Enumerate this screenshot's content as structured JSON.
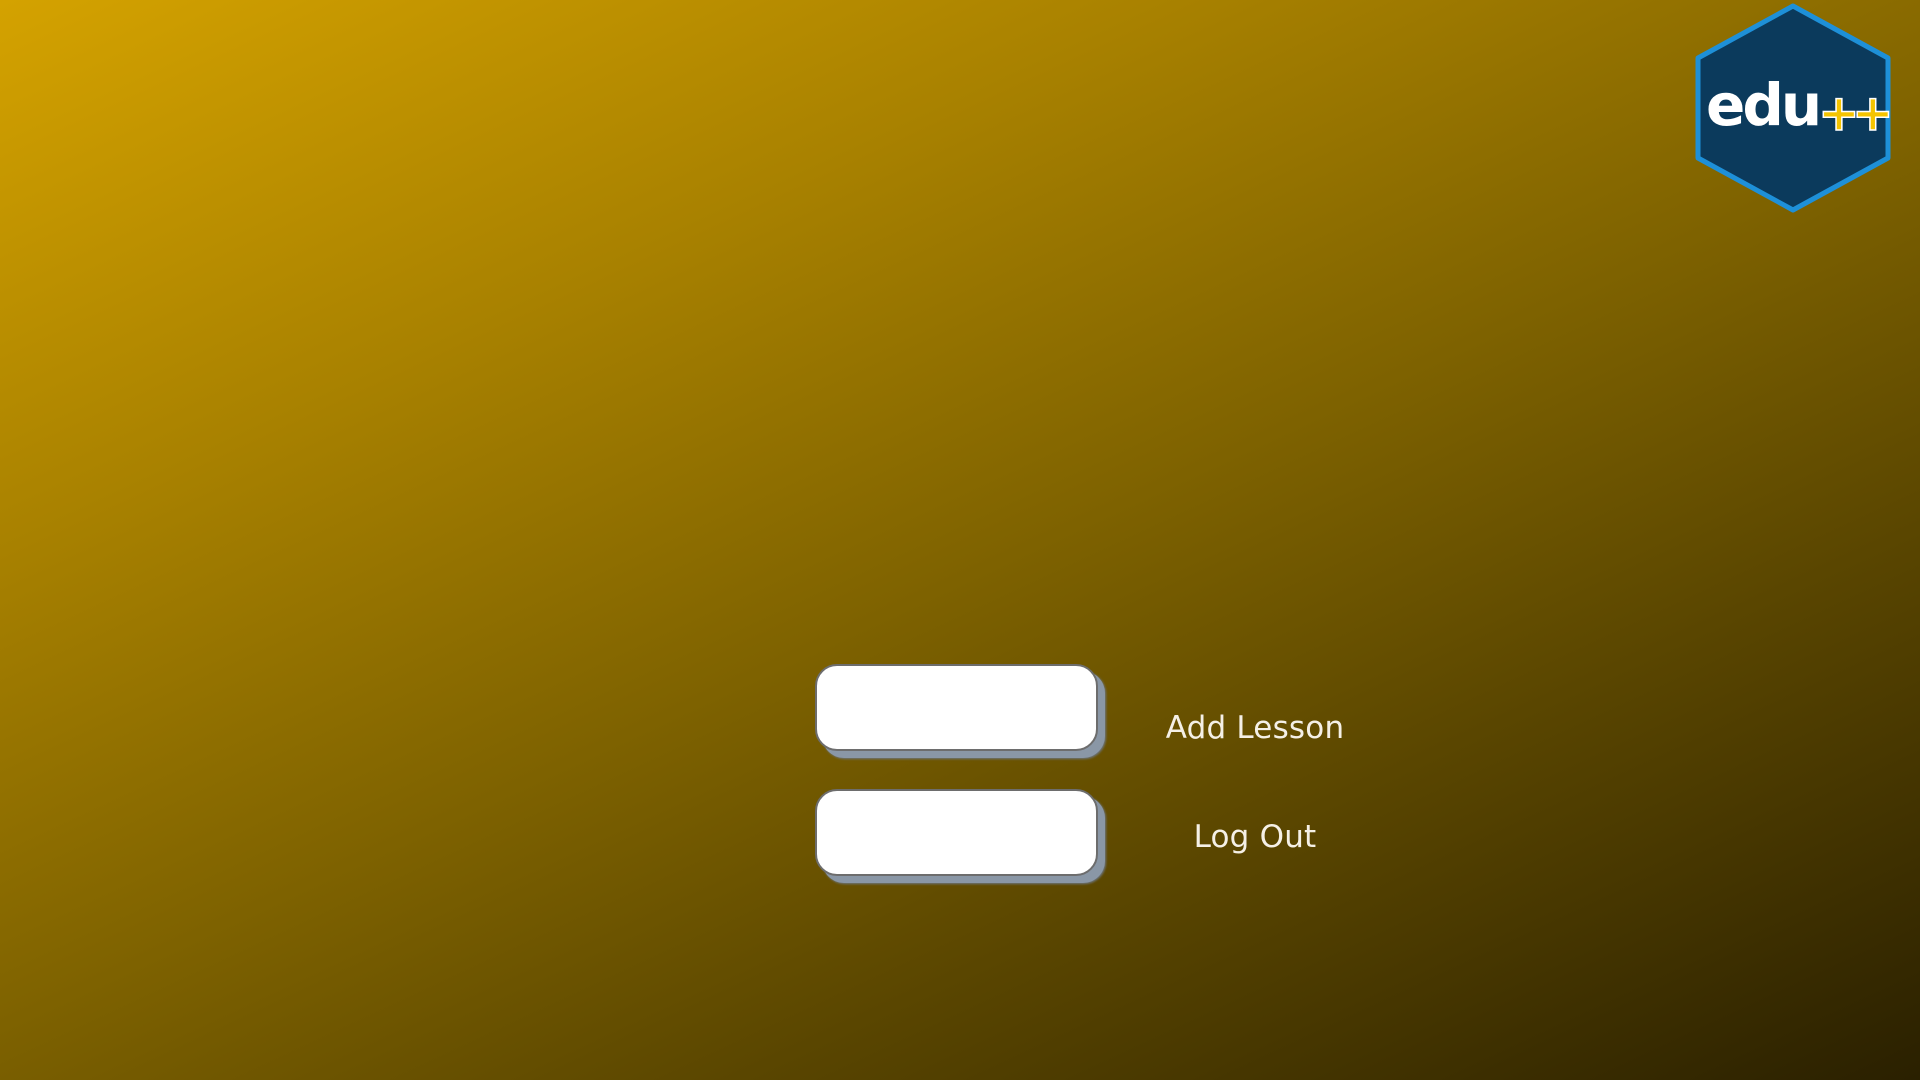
{
  "logo": {
    "text_main": "edu",
    "text_accent": "++",
    "hex_color": "#0b3a5c",
    "hex_border_color": "#1e90d8",
    "accent_color": "#f5c400"
  },
  "menu": {
    "add_lesson_label": "Add Lesson",
    "log_out_label": "Log Out"
  },
  "theme": {
    "background_top": "#d4a200",
    "background_bottom": "#2a2000",
    "button_fill": "#ffffff",
    "label_color": "#f5f0e6"
  }
}
